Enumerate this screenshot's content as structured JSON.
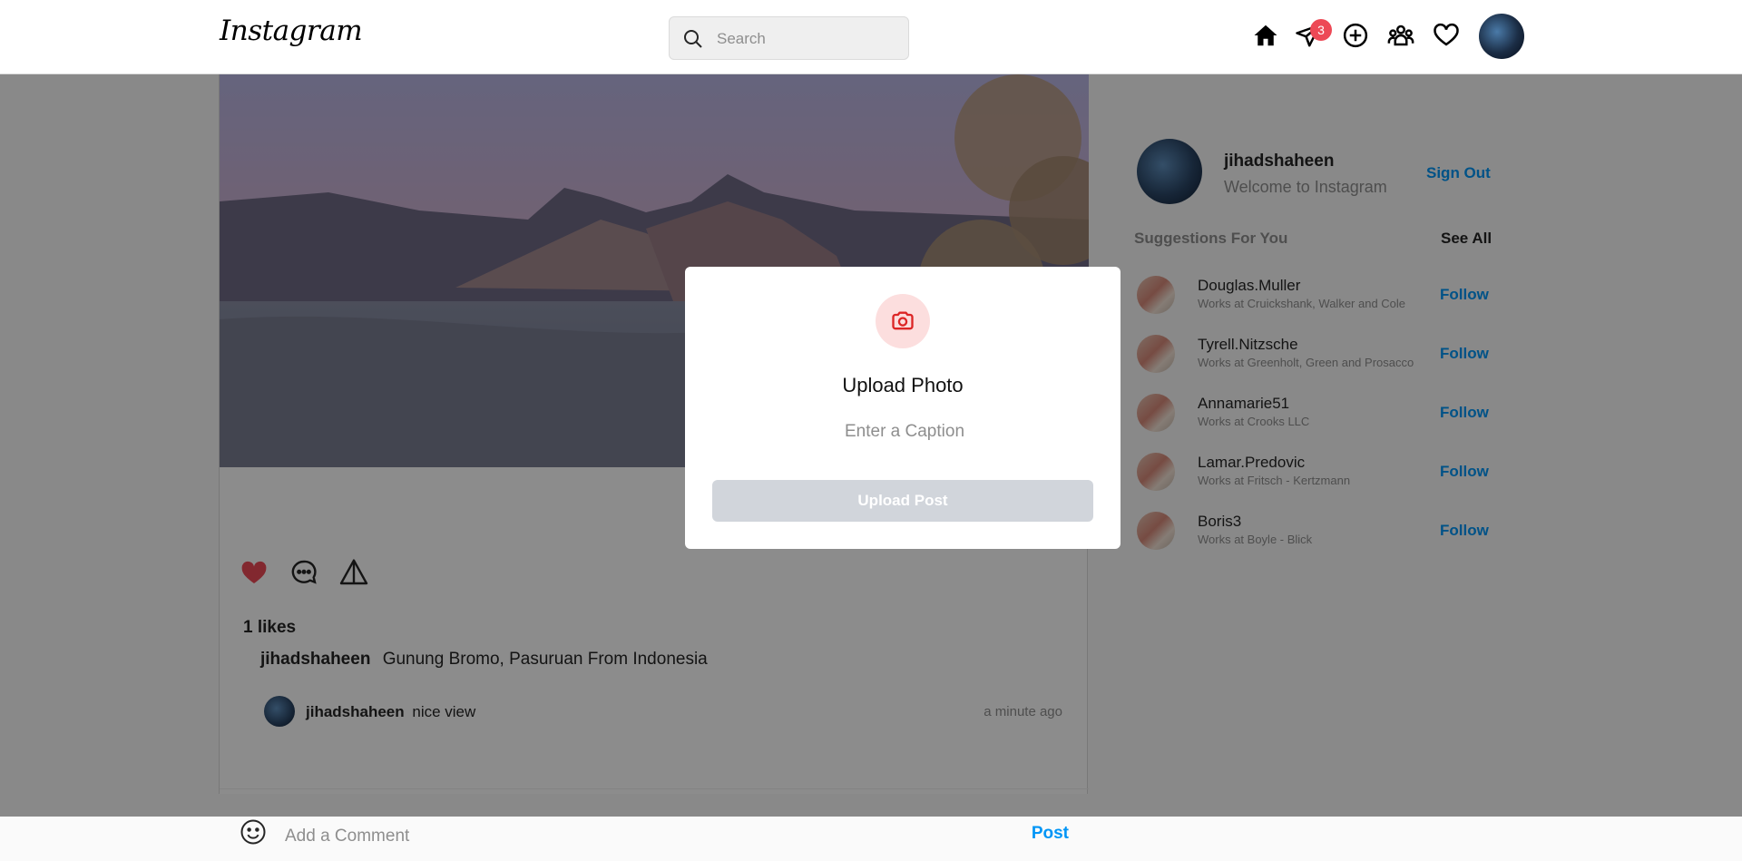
{
  "header": {
    "logo": "Instagram",
    "search_placeholder": "Search",
    "messages_badge": "3"
  },
  "post": {
    "likes": "1 likes",
    "caption_user": "jihadshaheen",
    "caption_text": "Gunung Bromo, Pasuruan From Indonesia",
    "comment": {
      "user": "jihadshaheen",
      "text": "nice view",
      "time": "a minute ago"
    },
    "add_comment_placeholder": "Add a Comment",
    "post_button": "Post"
  },
  "sidebar": {
    "username": "jihadshaheen",
    "welcome": "Welcome to Instagram",
    "sign_out": "Sign Out",
    "suggestions_title": "Suggestions For You",
    "see_all": "See All",
    "suggestions": [
      {
        "name": "Douglas.Muller",
        "sub": "Works at Cruickshank, Walker and Cole",
        "follow": "Follow"
      },
      {
        "name": "Tyrell.Nitzsche",
        "sub": "Works at Greenholt, Green and Prosacco",
        "follow": "Follow"
      },
      {
        "name": "Annamarie51",
        "sub": "Works at Crooks LLC",
        "follow": "Follow"
      },
      {
        "name": "Lamar.Predovic",
        "sub": "Works at Fritsch - Kertzmann",
        "follow": "Follow"
      },
      {
        "name": "Boris3",
        "sub": "Works at Boyle - Blick",
        "follow": "Follow"
      }
    ]
  },
  "modal": {
    "title": "Upload Photo",
    "caption_placeholder": "Enter a Caption",
    "upload_button": "Upload Post"
  },
  "colors": {
    "accent": "#0095f6",
    "like": "#ed4956",
    "badge": "#ed4956",
    "disabled_button": "#d1d5db"
  }
}
